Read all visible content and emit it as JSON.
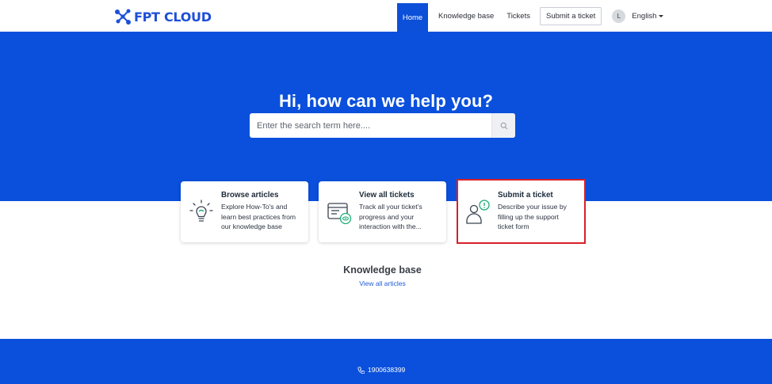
{
  "header": {
    "logo_text": "FPT CLOUD",
    "nav": {
      "home": "Home",
      "knowledge_base": "Knowledge base",
      "tickets": "Tickets",
      "submit_ticket": "Submit a ticket"
    },
    "avatar_initial": "L",
    "language": "English"
  },
  "hero": {
    "title": "Hi, how can we help you?",
    "search_placeholder": "Enter the search term here...."
  },
  "cards": [
    {
      "title": "Browse articles",
      "desc": "Explore How-To's and learn best practices from our knowledge base",
      "icon": "lightbulb-icon"
    },
    {
      "title": "View all tickets",
      "desc": "Track all your ticket's progress and your interaction with the...",
      "icon": "ticket-view-icon"
    },
    {
      "title": "Submit a ticket",
      "desc": "Describe your issue by filling up the support ticket form",
      "icon": "user-alert-icon"
    }
  ],
  "knowledge_base": {
    "title": "Knowledge base",
    "link": "View all articles"
  },
  "footer": {
    "phone": "1900638399"
  },
  "colors": {
    "brand_blue": "#0a50dc",
    "icon_green": "#1fae7a",
    "highlight_red": "#d8202a"
  }
}
